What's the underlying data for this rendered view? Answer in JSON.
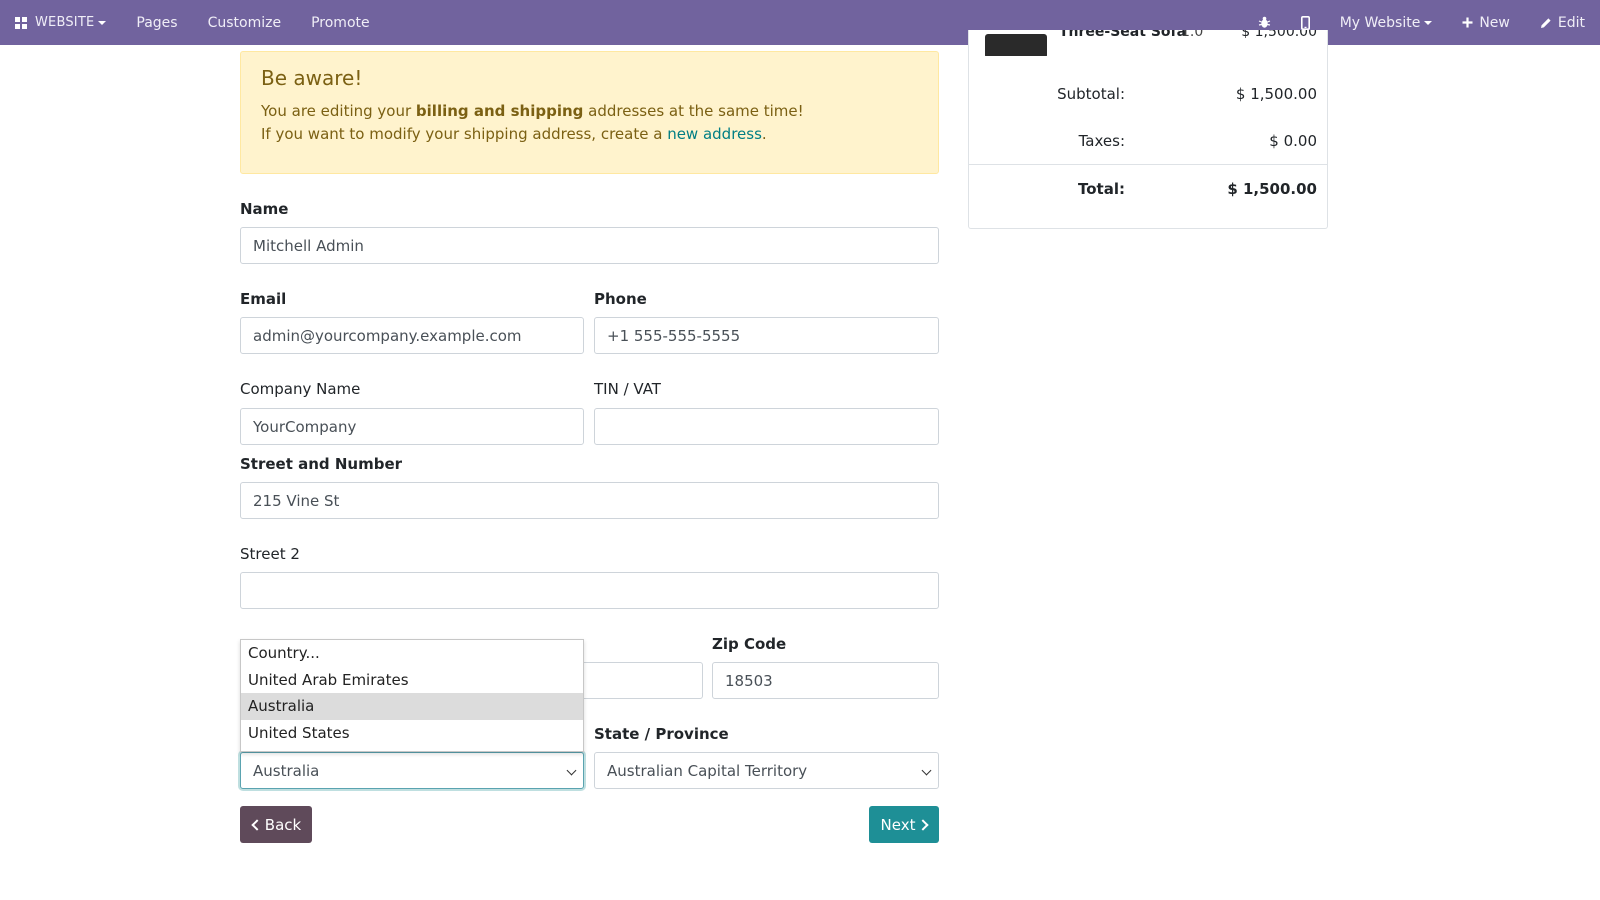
{
  "topbar": {
    "brand": "WEBSITE",
    "menu": [
      "Pages",
      "Customize",
      "Promote"
    ],
    "website_selector": "My Website",
    "new_label": "New",
    "edit_label": "Edit"
  },
  "alert": {
    "title": "Be aware!",
    "line1_pre": "You are editing your ",
    "line1_bold": "billing and shipping",
    "line1_post": " addresses at the same time!",
    "line2_pre": "If you want to modify your shipping address, create a ",
    "line2_link": "new address",
    "line2_post": "."
  },
  "form": {
    "name_label": "Name",
    "name_value": "Mitchell Admin",
    "email_label": "Email",
    "email_value": "admin@yourcompany.example.com",
    "phone_label": "Phone",
    "phone_value": "+1 555-555-5555",
    "company_label": "Company Name",
    "company_value": "YourCompany",
    "vat_label": "TIN / VAT",
    "vat_value": "",
    "street_label": "Street and Number",
    "street_value": "215 Vine St",
    "street2_label": "Street 2",
    "street2_value": "",
    "zip_label": "Zip Code",
    "zip_value": "18503",
    "country_value": "Australia",
    "state_label": "State / Province",
    "state_value": "Australian Capital Territory"
  },
  "country_dropdown": {
    "options": [
      "Country...",
      "United Arab Emirates",
      "Australia",
      "United States"
    ],
    "highlighted": "Australia"
  },
  "buttons": {
    "back": "Back",
    "next": "Next"
  },
  "summary": {
    "product_name": "Three-Seat Sofa",
    "product_qty": "1.0",
    "product_price": "$ 1,500.00",
    "subtotal_label": "Subtotal:",
    "subtotal_value": "$ 1,500.00",
    "taxes_label": "Taxes:",
    "taxes_value": "$ 0.00",
    "total_label": "Total:",
    "total_value": "$ 1,500.00"
  },
  "colors": {
    "navbar": "#71639e",
    "alert_bg": "#fff3cd",
    "primary": "#1e8f96",
    "back_button": "#5f4a5a"
  }
}
